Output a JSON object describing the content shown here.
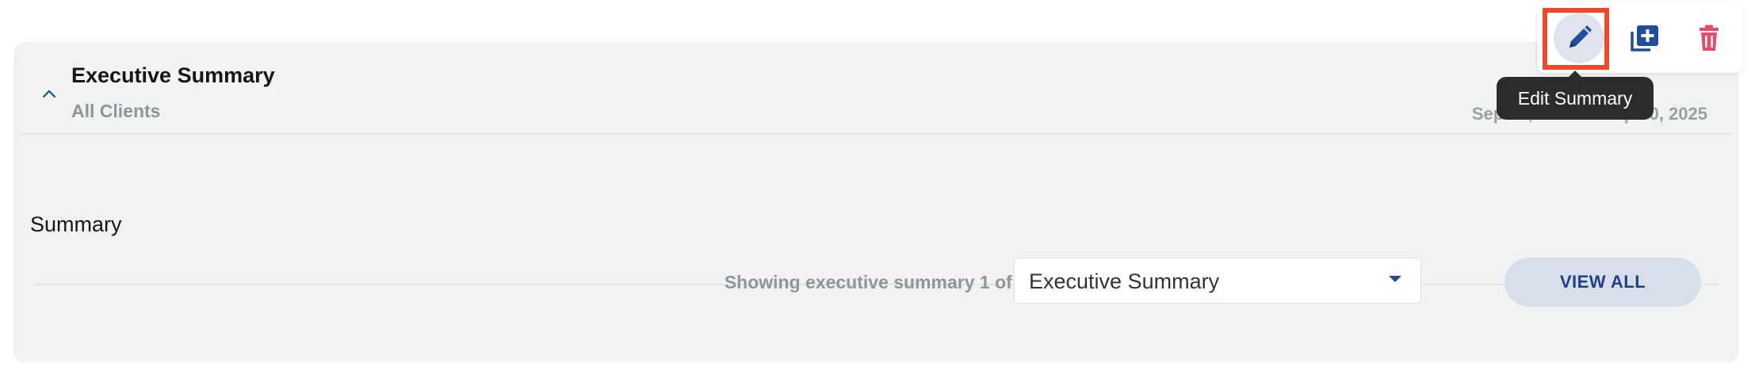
{
  "card": {
    "title": "Executive Summary",
    "subtitle": "All Clients",
    "date_range": "Sep 01, 2025 to Sep 30, 2025",
    "body_text": "Summary"
  },
  "footer": {
    "pager_text": "Showing executive summary 1 of 1",
    "select_value": "Executive Summary",
    "view_all_label": "VIEW ALL"
  },
  "toolbar": {
    "edit_icon": "pencil-icon",
    "add_icon": "add-copy-icon",
    "delete_icon": "trash-icon",
    "tooltip": "Edit Summary"
  },
  "colors": {
    "accent": "#1e4f9c",
    "delete": "#e84a6a",
    "highlight": "#ec4a2a",
    "card_bg": "#f1f2f2"
  }
}
